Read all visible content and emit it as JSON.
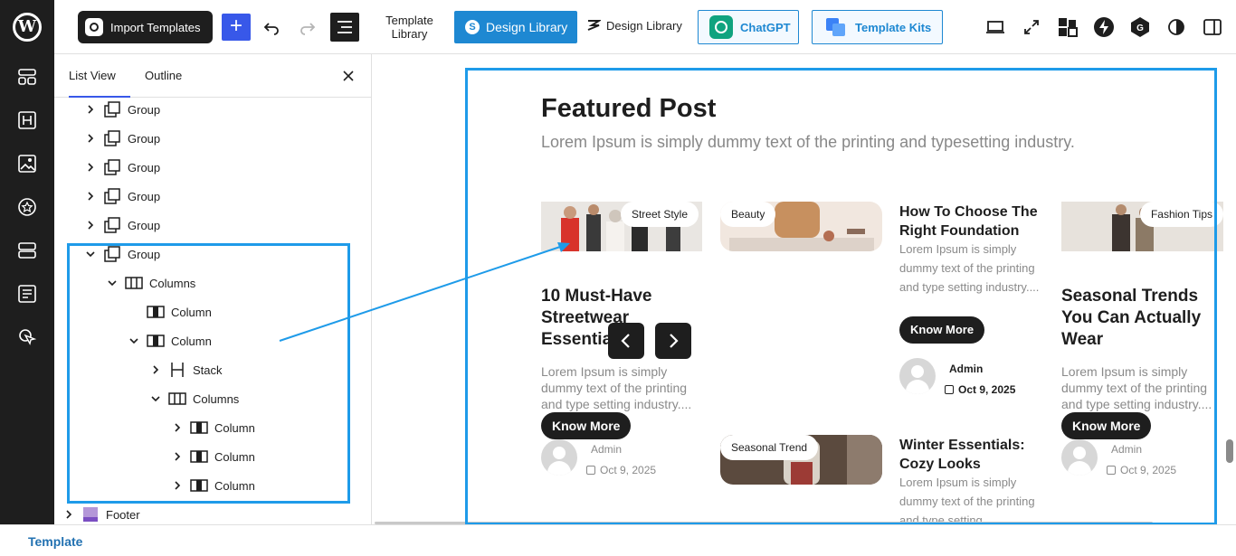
{
  "app": {
    "name": "WordPress Site Editor"
  },
  "toolbar": {
    "import_label": "Import Templates",
    "template_library_label": "Template Library",
    "design_library_label": "Design Library",
    "design_library_alt_label": "Design Library",
    "chatgpt_label": "ChatGPT",
    "template_kits_label": "Template Kits"
  },
  "panel": {
    "tabs": [
      "List View",
      "Outline"
    ],
    "tree": [
      {
        "label": "Group",
        "depth": 0,
        "expanded": false
      },
      {
        "label": "Group",
        "depth": 0,
        "expanded": false
      },
      {
        "label": "Group",
        "depth": 0,
        "expanded": false
      },
      {
        "label": "Group",
        "depth": 0,
        "expanded": false
      },
      {
        "label": "Group",
        "depth": 0,
        "expanded": false
      },
      {
        "label": "Group",
        "depth": 0,
        "expanded": true
      },
      {
        "label": "Columns",
        "depth": 1,
        "expanded": true
      },
      {
        "label": "Column",
        "depth": 2,
        "expanded": null
      },
      {
        "label": "Column",
        "depth": 2,
        "expanded": true
      },
      {
        "label": "Stack",
        "depth": 3,
        "expanded": false
      },
      {
        "label": "Columns",
        "depth": 3,
        "expanded": true
      },
      {
        "label": "Column",
        "depth": 4,
        "expanded": false
      },
      {
        "label": "Column",
        "depth": 4,
        "expanded": false
      },
      {
        "label": "Column",
        "depth": 4,
        "expanded": false
      },
      {
        "label": "Footer",
        "depth": -1,
        "expanded": false
      }
    ]
  },
  "canvas": {
    "title": "Featured Post",
    "subtitle": "Lorem Ipsum is simply dummy text of the printing and typesetting industry.",
    "posts": {
      "p1": {
        "tag": "Street Style",
        "title": "10 Must-Have Streetwear Essentials",
        "desc": "Lorem Ipsum is simply dummy text of the printing and type setting industry....",
        "button": "Know More",
        "author": "Admin",
        "date": "Oct 9, 2025"
      },
      "p2": {
        "tag": "Beauty",
        "title": "How To Choose The Right Foundation",
        "desc": "Lorem Ipsum is simply dummy text of the printing and type setting industry....",
        "button": "Know More",
        "author": "Admin",
        "date": "Oct 9, 2025"
      },
      "p3": {
        "tag": "Seasonal Trend",
        "title": "Winter Essentials: Cozy Looks",
        "desc": "Lorem Ipsum is simply dummy text of the printing and type setting"
      },
      "p4": {
        "tag": "Fashion Tips",
        "title": "Seasonal Trends You Can Actually Wear",
        "desc": "Lorem Ipsum is simply dummy text of the printing and type setting industry....",
        "button": "Know More",
        "author": "Admin",
        "date": "Oct 9, 2025"
      }
    }
  },
  "footer": {
    "breadcrumb": "Template"
  },
  "colors": {
    "accent": "#1e9be9",
    "wp_blue": "#3858e9",
    "design_blue": "#1e88d2",
    "dark": "#1e1e1e"
  }
}
